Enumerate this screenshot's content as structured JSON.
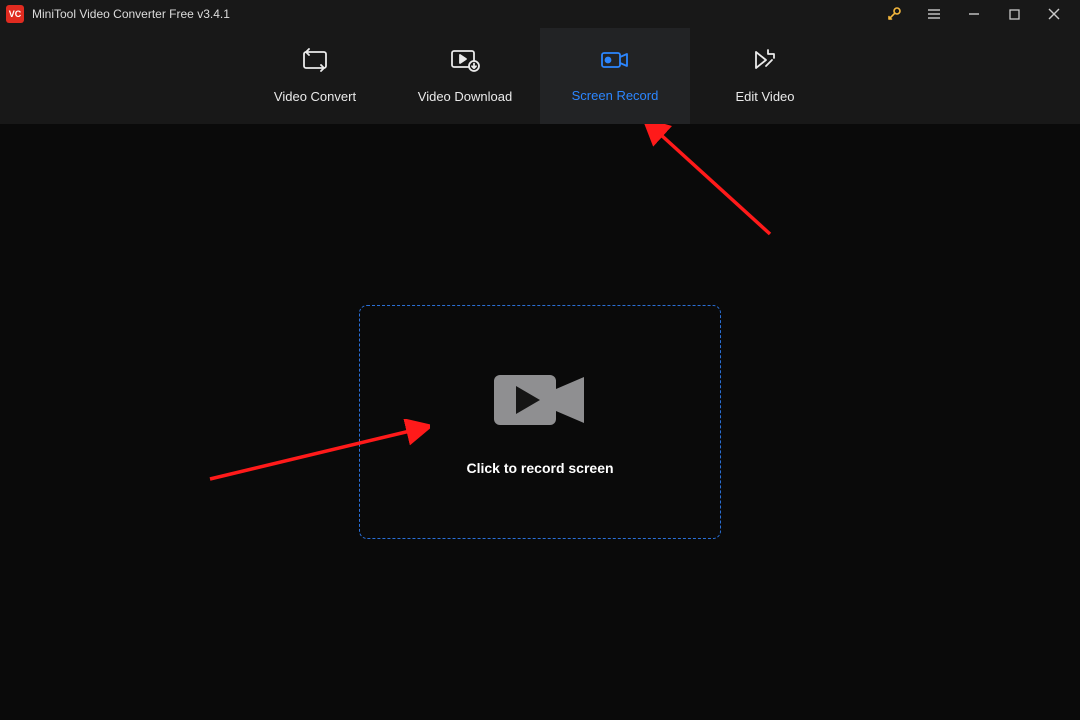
{
  "titlebar": {
    "app_title": "MiniTool Video Converter Free v3.4.1",
    "logo_text": "VC"
  },
  "tabs": {
    "convert": "Video Convert",
    "download": "Video Download",
    "record": "Screen Record",
    "edit": "Edit Video"
  },
  "main": {
    "record_cta": "Click to record screen"
  }
}
